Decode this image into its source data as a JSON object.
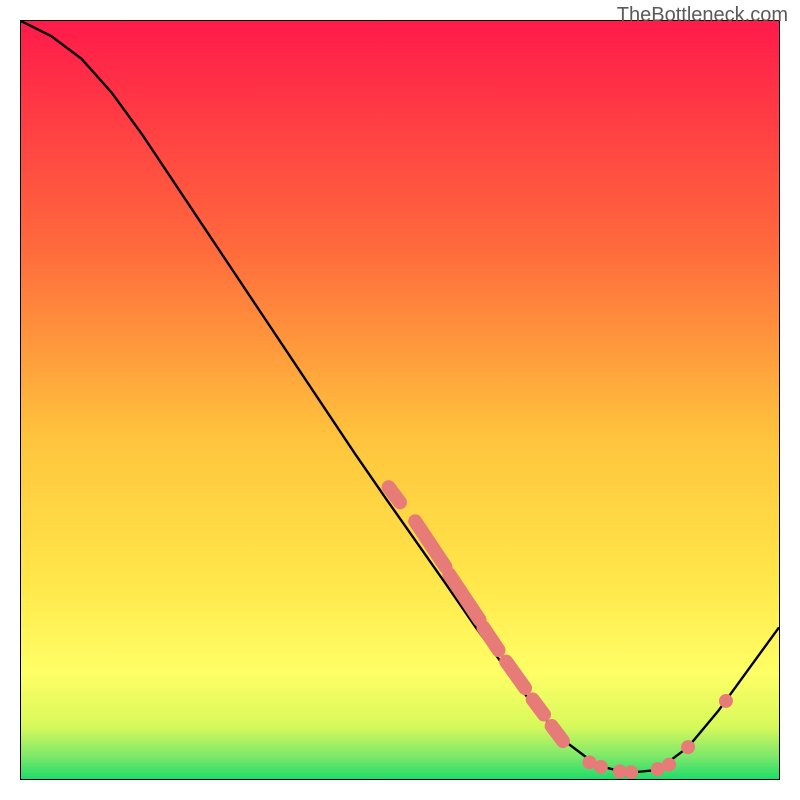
{
  "watermark": "TheBottleneck.com",
  "colors": {
    "top": "#ff1a4a",
    "mid1": "#ff7a3c",
    "mid2": "#ffd23c",
    "lowYellow": "#ffff55",
    "green": "#1fe06a",
    "curve": "#000000",
    "dot": "#e67b78"
  },
  "chart_data": {
    "type": "line",
    "title": "",
    "xlabel": "",
    "ylabel": "",
    "xlim": [
      0,
      100
    ],
    "ylim": [
      0,
      100
    ],
    "curve": [
      {
        "x": 0,
        "y": 100
      },
      {
        "x": 4,
        "y": 98
      },
      {
        "x": 8,
        "y": 95
      },
      {
        "x": 12,
        "y": 90.5
      },
      {
        "x": 16,
        "y": 85
      },
      {
        "x": 20,
        "y": 79
      },
      {
        "x": 24,
        "y": 73
      },
      {
        "x": 28,
        "y": 67
      },
      {
        "x": 32,
        "y": 61
      },
      {
        "x": 36,
        "y": 55
      },
      {
        "x": 40,
        "y": 49
      },
      {
        "x": 44,
        "y": 43
      },
      {
        "x": 48,
        "y": 37.2
      },
      {
        "x": 52,
        "y": 31.5
      },
      {
        "x": 56,
        "y": 25.8
      },
      {
        "x": 60,
        "y": 20
      },
      {
        "x": 64,
        "y": 14.5
      },
      {
        "x": 68,
        "y": 9.2
      },
      {
        "x": 72,
        "y": 4.8
      },
      {
        "x": 76,
        "y": 1.8
      },
      {
        "x": 80,
        "y": 0.8
      },
      {
        "x": 84,
        "y": 1.2
      },
      {
        "x": 88,
        "y": 4.2
      },
      {
        "x": 92,
        "y": 9
      },
      {
        "x": 96,
        "y": 14.5
      },
      {
        "x": 100,
        "y": 20
      }
    ],
    "dot_clusters": [
      {
        "from": {
          "x": 48.5,
          "y": 38.5
        },
        "to": {
          "x": 50,
          "y": 36.5
        }
      },
      {
        "from": {
          "x": 52,
          "y": 34
        },
        "to": {
          "x": 56,
          "y": 28
        }
      },
      {
        "from": {
          "x": 56.5,
          "y": 27
        },
        "to": {
          "x": 60.5,
          "y": 21
        }
      },
      {
        "from": {
          "x": 61,
          "y": 20
        },
        "to": {
          "x": 63,
          "y": 17
        }
      },
      {
        "from": {
          "x": 64,
          "y": 15.5
        },
        "to": {
          "x": 66.5,
          "y": 12
        }
      },
      {
        "from": {
          "x": 67.5,
          "y": 10.5
        },
        "to": {
          "x": 69,
          "y": 8.5
        }
      },
      {
        "from": {
          "x": 70,
          "y": 7
        },
        "to": {
          "x": 71.5,
          "y": 5
        }
      }
    ],
    "single_dots": [
      {
        "x": 75,
        "y": 2.2
      },
      {
        "x": 76.5,
        "y": 1.6
      },
      {
        "x": 79,
        "y": 1.0
      },
      {
        "x": 80.5,
        "y": 0.9
      },
      {
        "x": 84,
        "y": 1.3
      },
      {
        "x": 85.5,
        "y": 1.9
      },
      {
        "x": 88,
        "y": 4.2
      },
      {
        "x": 93,
        "y": 10.3
      }
    ],
    "dot_radius": 7
  }
}
